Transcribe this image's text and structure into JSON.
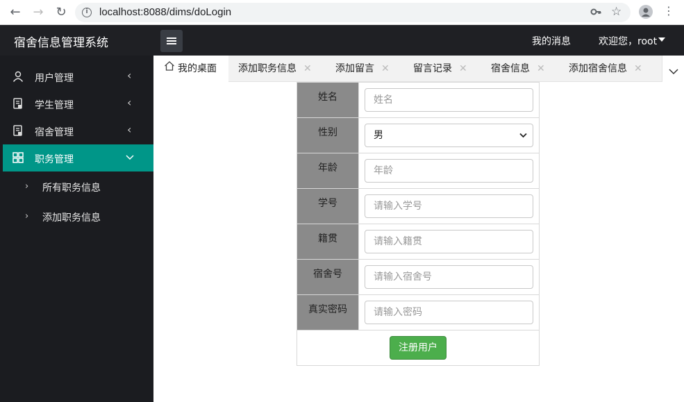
{
  "browser": {
    "url": "localhost:8088/dims/doLogin"
  },
  "header": {
    "app_title": "宿舍信息管理系统",
    "messages_label": "我的消息",
    "welcome_label": "欢迎您，root"
  },
  "sidebar": {
    "items": [
      {
        "label": "用户管理",
        "icon": "user-icon"
      },
      {
        "label": "学生管理",
        "icon": "document-icon"
      },
      {
        "label": "宿舍管理",
        "icon": "document-icon"
      },
      {
        "label": "职务管理",
        "icon": "grid-icon",
        "active": true
      }
    ],
    "sub_items": [
      {
        "label": "所有职务信息"
      },
      {
        "label": "添加职务信息"
      }
    ]
  },
  "tabs": [
    {
      "label": "我的桌面"
    },
    {
      "label": "添加职务信息"
    },
    {
      "label": "添加留言"
    },
    {
      "label": "留言记录"
    },
    {
      "label": "宿舍信息"
    },
    {
      "label": "添加宿舍信息"
    }
  ],
  "form": {
    "fields": [
      {
        "label": "姓名",
        "placeholder": "姓名"
      },
      {
        "label": "性别",
        "value": "男"
      },
      {
        "label": "年龄",
        "placeholder": "年龄"
      },
      {
        "label": "学号",
        "placeholder": "请输入学号"
      },
      {
        "label": "籍贯",
        "placeholder": "请输入籍贯"
      },
      {
        "label": "宿舍号",
        "placeholder": "请输入宿舍号"
      },
      {
        "label": "真实密码",
        "placeholder": "请输入密码"
      }
    ],
    "submit_label": "注册用户"
  },
  "colors": {
    "sidebar_bg": "#1b1c20",
    "active_item": "#009688",
    "button_green": "#4cae4c",
    "label_cell_bg": "#8a8a8a"
  }
}
